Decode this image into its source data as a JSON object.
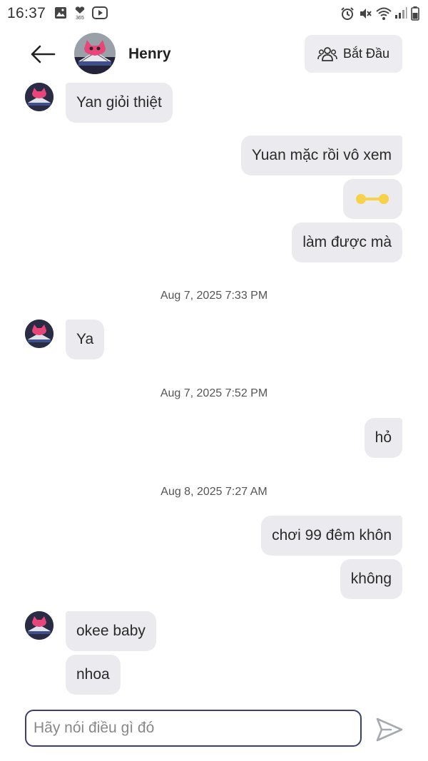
{
  "status_bar": {
    "time": "16:37",
    "icons": [
      "gallery-icon",
      "heart-365-icon",
      "youtube-icon",
      "alarm-icon",
      "mute-icon",
      "wifi-icon",
      "signal-icon",
      "battery-icon"
    ]
  },
  "header": {
    "contact_name": "Henry",
    "start_button_label": "Bắt Đầu",
    "icons": [
      "back-arrow-icon",
      "group-icon"
    ]
  },
  "messages": [
    {
      "dir": "in",
      "text": "Yan giỏi thiệt"
    },
    {
      "dir": "out",
      "text": "Yuan mặc rồi vô xem"
    },
    {
      "dir": "out",
      "type": "emoji",
      "emoji_name": "yellow-dumbbell-sticker"
    },
    {
      "dir": "out",
      "text": "làm được mà"
    },
    {
      "type": "timestamp",
      "text": "Aug 7, 2025 7:33 PM"
    },
    {
      "dir": "in",
      "text": "Ya"
    },
    {
      "type": "timestamp",
      "text": "Aug 7, 2025 7:52 PM"
    },
    {
      "dir": "out",
      "text": "hỏ"
    },
    {
      "type": "timestamp",
      "text": "Aug 8, 2025 7:27 AM"
    },
    {
      "dir": "out",
      "text": "chơi 99 đêm khôn"
    },
    {
      "dir": "out",
      "text": "không"
    },
    {
      "dir": "in",
      "text": "okee baby"
    },
    {
      "dir": "in",
      "text": "nhoa"
    }
  ],
  "composer": {
    "placeholder": "Hãy nói điều gì đó",
    "value": "",
    "send_icon": "send-icon"
  },
  "colors": {
    "bubble": "#ebebef",
    "composer_border": "#3a3f6e",
    "emoji": "#f6d24a"
  }
}
